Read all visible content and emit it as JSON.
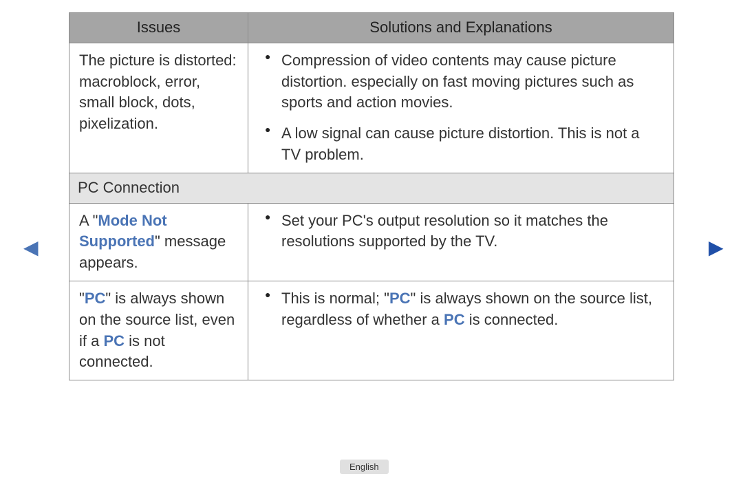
{
  "headers": {
    "issues": "Issues",
    "solutions": "Solutions and Explanations"
  },
  "rows": {
    "r1": {
      "issue": "The picture is distorted: macroblock, error, small block, dots, pixelization.",
      "bullets": [
        "Compression of video contents may cause picture distortion. especially on fast moving pictures such as sports and action movies.",
        "A low signal can cause picture distortion. This is not a TV problem."
      ]
    },
    "section1": "PC Connection",
    "r2": {
      "issue_pre": "A \"",
      "issue_hi": "Mode Not Supported",
      "issue_post": "\" message appears.",
      "bullets": [
        "Set your PC's output resolution so it matches the resolutions supported by the TV."
      ]
    },
    "r3": {
      "issue_p1": "\"",
      "issue_h1": "PC",
      "issue_p2": "\" is always shown on the source list, even if a ",
      "issue_h2": "PC",
      "issue_p3": " is not connected.",
      "sol_p1": "This is normal; \"",
      "sol_h1": "PC",
      "sol_p2": "\" is always shown on the source list, regardless of whether a ",
      "sol_h2": "PC",
      "sol_p3": " is connected."
    }
  },
  "nav": {
    "prev": "◀",
    "next": "▶"
  },
  "language": "English"
}
